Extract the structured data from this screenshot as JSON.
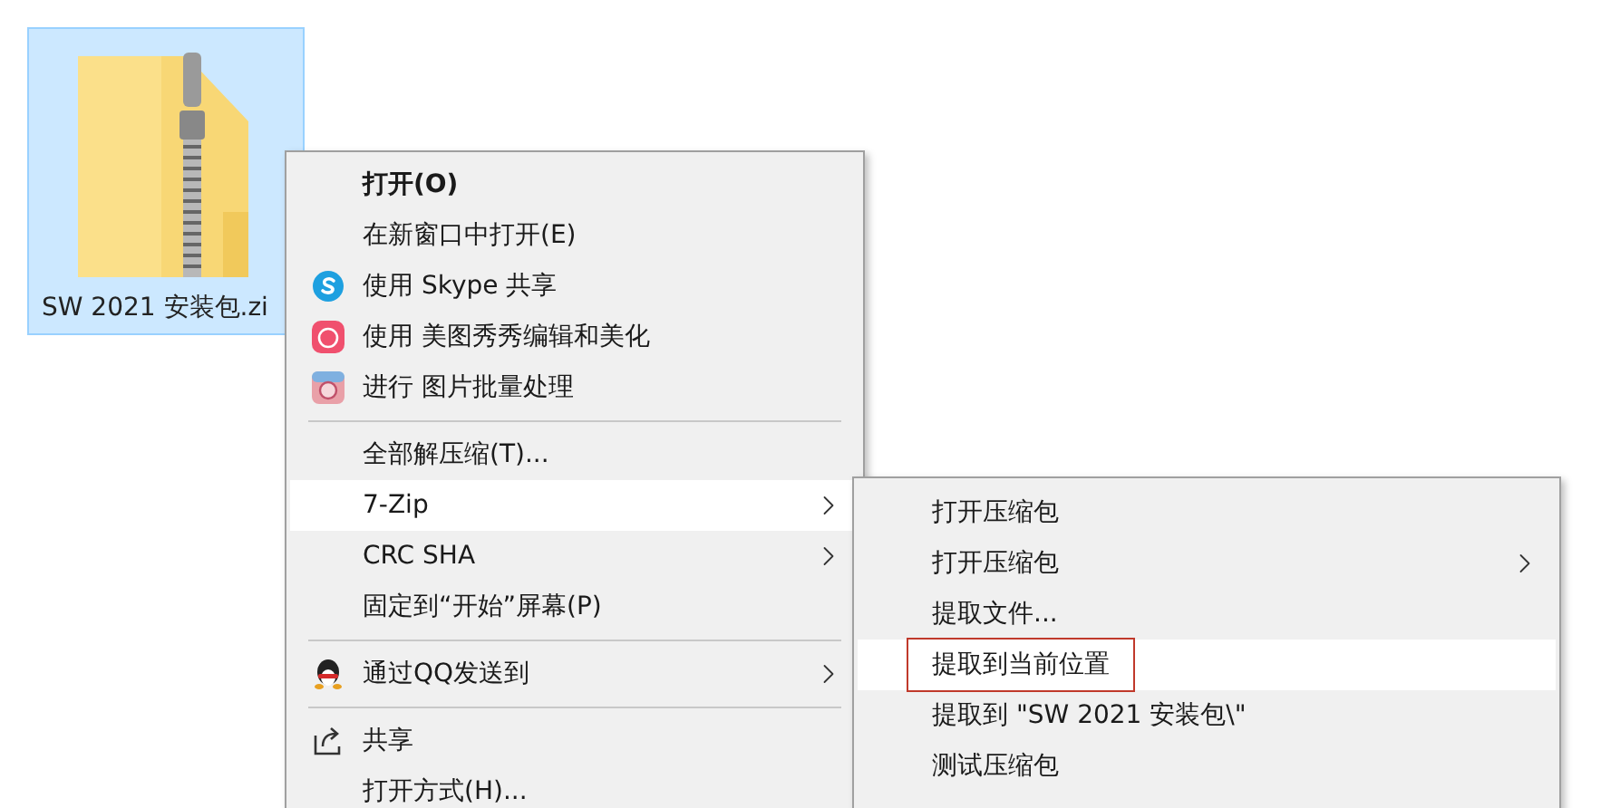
{
  "desktop_file": {
    "label": "SW 2021 安装包.zi",
    "selected": true
  },
  "context_menu": {
    "items": [
      {
        "kind": "item",
        "label": "打开(O)",
        "default": true,
        "submenu": false,
        "selected": false
      },
      {
        "kind": "item",
        "label": "在新窗口中打开(E)",
        "default": false,
        "submenu": false,
        "selected": false
      },
      {
        "kind": "item",
        "label": "使用 Skype 共享",
        "default": false,
        "submenu": false,
        "selected": false
      },
      {
        "kind": "item",
        "label": "使用 美图秀秀编辑和美化",
        "default": false,
        "submenu": false,
        "selected": false
      },
      {
        "kind": "item",
        "label": "进行 图片批量处理",
        "default": false,
        "submenu": false,
        "selected": false
      },
      {
        "kind": "separator"
      },
      {
        "kind": "item",
        "label": "全部解压缩(T)...",
        "default": false,
        "submenu": false,
        "selected": false
      },
      {
        "kind": "item",
        "label": "7-Zip",
        "default": false,
        "submenu": true,
        "selected": true
      },
      {
        "kind": "item",
        "label": "CRC SHA",
        "default": false,
        "submenu": true,
        "selected": false
      },
      {
        "kind": "item",
        "label": "固定到“开始”屏幕(P)",
        "default": false,
        "submenu": false,
        "selected": false
      },
      {
        "kind": "separator"
      },
      {
        "kind": "item",
        "label": "通过QQ发送到",
        "default": false,
        "submenu": true,
        "selected": false
      },
      {
        "kind": "separator"
      },
      {
        "kind": "item",
        "label": "共享",
        "default": false,
        "submenu": false,
        "selected": false
      },
      {
        "kind": "item",
        "label": "打开方式(H)...",
        "default": false,
        "submenu": false,
        "selected": false
      }
    ]
  },
  "submenu": {
    "items": [
      {
        "label": "打开压缩包",
        "submenu": false,
        "selected": false,
        "marked": false
      },
      {
        "label": "打开压缩包",
        "submenu": true,
        "selected": false,
        "marked": false
      },
      {
        "label": "提取文件...",
        "submenu": false,
        "selected": false,
        "marked": false
      },
      {
        "label": "提取到当前位置",
        "submenu": false,
        "selected": true,
        "marked": true
      },
      {
        "label": "提取到 \"SW 2021 安装包\\\"",
        "submenu": false,
        "selected": false,
        "marked": false
      },
      {
        "label": "测试压缩包",
        "submenu": false,
        "selected": false,
        "marked": false
      }
    ]
  }
}
